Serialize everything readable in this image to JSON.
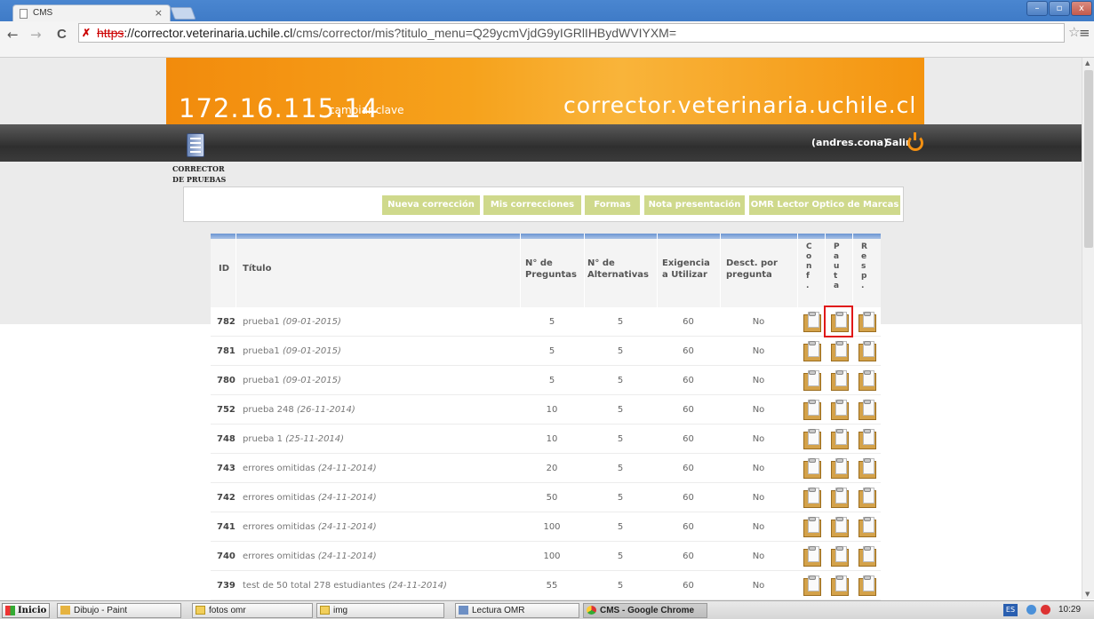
{
  "browser": {
    "tab_title": "CMS",
    "tab_close": "×",
    "url_scheme": "https",
    "url_host": "://corrector.veterinaria.uchile.cl",
    "url_path": "/cms/corrector/mis?titulo_menu=Q29ycmVjdG9yIGRlIHBydWVIYXM=",
    "back": "←",
    "forward": "→",
    "reload": "C",
    "star": "☆",
    "menu": "≡",
    "win_min": "–",
    "win_max": "▫",
    "win_close": "x"
  },
  "header": {
    "ip": "172.16.115.14",
    "change_password": "cambiar clave",
    "site": "corrector.veterinaria.uchile.cl",
    "user": "(andres.cona)",
    "logout": "Salir",
    "logo_line1": "CORRECTOR",
    "logo_line2": "DE PRUEBAS"
  },
  "menu": [
    "Nueva corrección",
    "Mis correcciones",
    "Formas",
    "Nota presentación",
    "OMR Lector Optico de Marcas"
  ],
  "table": {
    "headers": {
      "id": "ID",
      "title": "Título",
      "preguntas": "N° de Preguntas",
      "alternativas": "N° de Alternativas",
      "exigencia": "Exigencia a Utilizar",
      "descuento": "Desct. por pregunta",
      "conf": "C o n f .",
      "pauta": "P a u t a",
      "resp": "R e s p ."
    },
    "rows": [
      {
        "id": "782",
        "name": "prueba1",
        "date": "(09-01-2015)",
        "preguntas": "5",
        "alternativas": "5",
        "exigencia": "60",
        "descuento": "No"
      },
      {
        "id": "781",
        "name": "prueba1",
        "date": "(09-01-2015)",
        "preguntas": "5",
        "alternativas": "5",
        "exigencia": "60",
        "descuento": "No"
      },
      {
        "id": "780",
        "name": "prueba1",
        "date": "(09-01-2015)",
        "preguntas": "5",
        "alternativas": "5",
        "exigencia": "60",
        "descuento": "No"
      },
      {
        "id": "752",
        "name": "prueba 248",
        "date": "(26-11-2014)",
        "preguntas": "10",
        "alternativas": "5",
        "exigencia": "60",
        "descuento": "No"
      },
      {
        "id": "748",
        "name": "prueba 1",
        "date": "(25-11-2014)",
        "preguntas": "10",
        "alternativas": "5",
        "exigencia": "60",
        "descuento": "No"
      },
      {
        "id": "743",
        "name": "errores omitidas",
        "date": "(24-11-2014)",
        "preguntas": "20",
        "alternativas": "5",
        "exigencia": "60",
        "descuento": "No"
      },
      {
        "id": "742",
        "name": "errores omitidas",
        "date": "(24-11-2014)",
        "preguntas": "50",
        "alternativas": "5",
        "exigencia": "60",
        "descuento": "No"
      },
      {
        "id": "741",
        "name": "errores omitidas",
        "date": "(24-11-2014)",
        "preguntas": "100",
        "alternativas": "5",
        "exigencia": "60",
        "descuento": "No"
      },
      {
        "id": "740",
        "name": "errores omitidas",
        "date": "(24-11-2014)",
        "preguntas": "100",
        "alternativas": "5",
        "exigencia": "60",
        "descuento": "No"
      },
      {
        "id": "739",
        "name": "test de 50 total 278 estudiantes",
        "date": "(24-11-2014)",
        "preguntas": "55",
        "alternativas": "5",
        "exigencia": "60",
        "descuento": "No"
      }
    ]
  },
  "taskbar": {
    "start": "Inicio",
    "items": [
      "Dibujo - Paint",
      "fotos omr",
      "img",
      "Lectura OMR",
      "CMS - Google Chrome"
    ],
    "lang": "ES",
    "clock": "10:29"
  },
  "colors": {
    "banner_orange": "#f6a21c",
    "menu_green": "#cfd98c",
    "highlight_red": "#e01818"
  }
}
